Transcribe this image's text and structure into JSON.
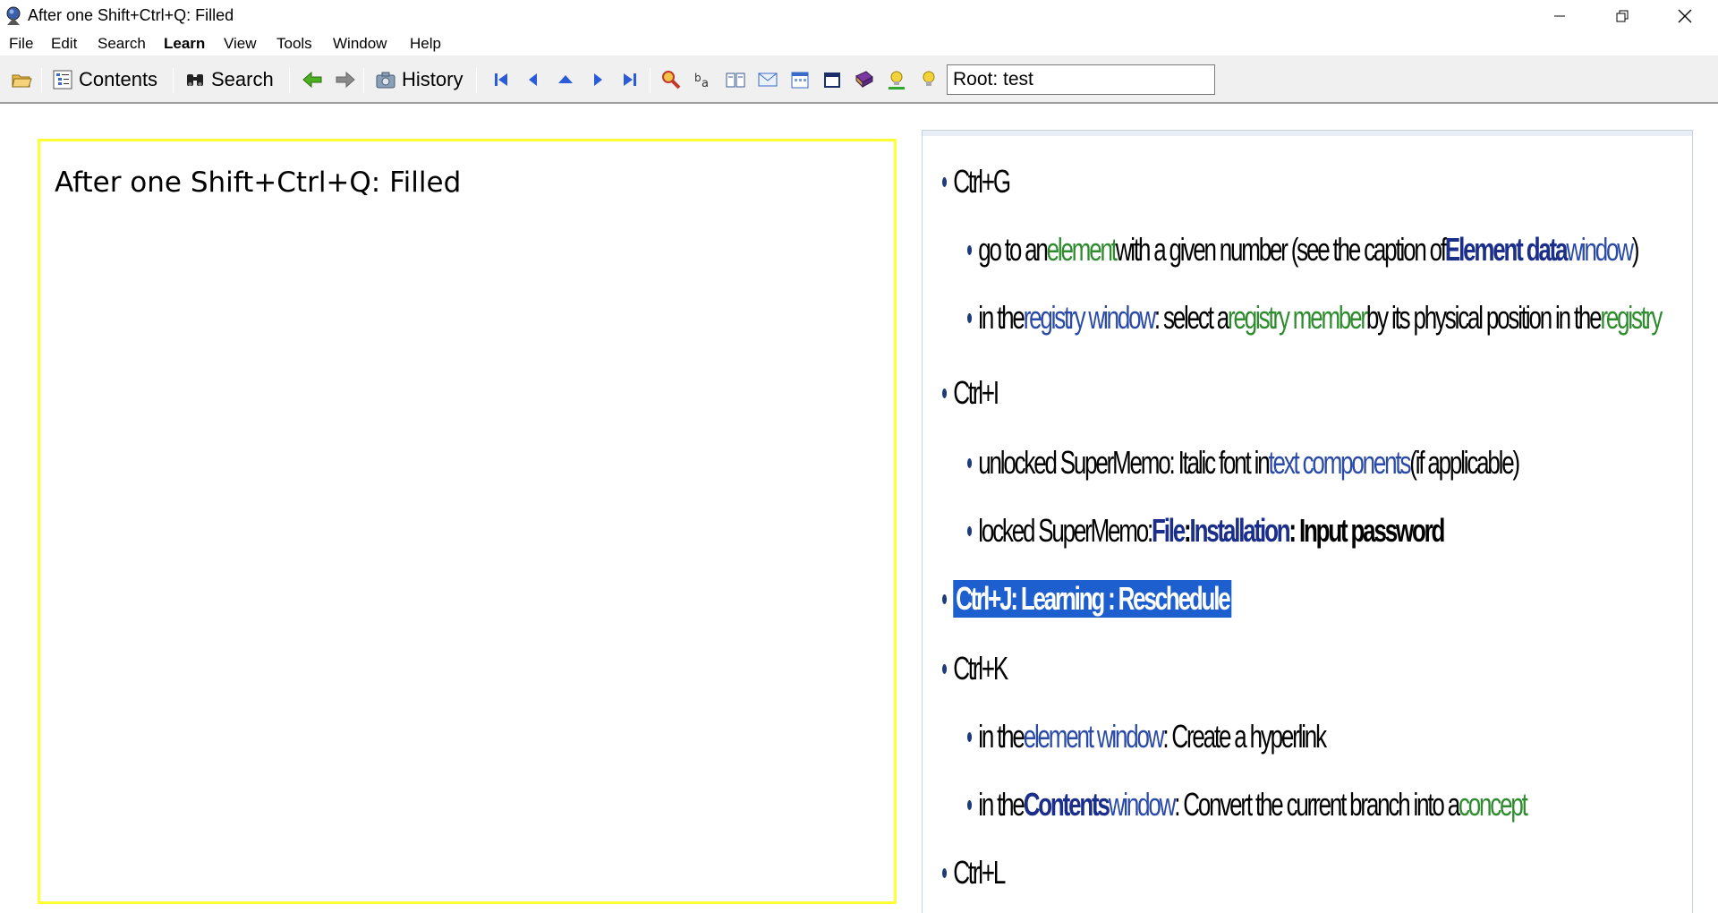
{
  "window": {
    "title": "After one Shift+Ctrl+Q: Filled"
  },
  "menu": {
    "items": [
      "File",
      "Edit",
      "Search",
      "Learn",
      "View",
      "Tools",
      "Window",
      "Help"
    ]
  },
  "toolbar": {
    "contents_label": "Contents",
    "search_label": "Search",
    "history_label": "History",
    "root_value": "Root: test"
  },
  "left_panel": {
    "text": "After one Shift+Ctrl+Q: Filled"
  },
  "right_panel": {
    "ctrl_g": "Ctrl+G",
    "ctrl_g_1": {
      "a": "go to an ",
      "b": "element",
      "c": " with a given number (see the caption of ",
      "d": "Element data",
      "e": " window",
      "f": ")"
    },
    "ctrl_g_2": {
      "a": "in the ",
      "b": "registry window",
      "c": ": select a ",
      "d": "registry member",
      "e": " by its physical position in the ",
      "f": "registry"
    },
    "ctrl_i": "Ctrl+I",
    "ctrl_i_1": {
      "a": "unlocked SuperMemo: Italic font in ",
      "b": "text components",
      "c": " (if applicable)"
    },
    "ctrl_i_2": {
      "a": "locked SuperMemo: ",
      "b": "File",
      "c": " : ",
      "d": "Installation",
      "e": " : Input password"
    },
    "ctrl_j": "Ctrl+J: Learning : Reschedule",
    "ctrl_k": "Ctrl+K",
    "ctrl_k_1": {
      "a": "in the ",
      "b": "element window",
      "c": ": Create a hyperlink"
    },
    "ctrl_k_2": {
      "a": "in the ",
      "b": "Contents",
      "c": " window",
      "d": ": Convert the current branch into a ",
      "e": "concept"
    },
    "ctrl_l": "Ctrl+L"
  },
  "colors": {
    "highlight": "#1e5fd0",
    "panel_border": "#ffff33",
    "link_green": "#2e8b2e",
    "link_blue": "#2a4aa8"
  }
}
